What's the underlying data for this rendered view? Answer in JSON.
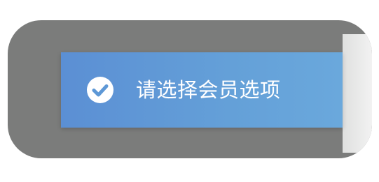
{
  "toast": {
    "message": "请选择会员选项",
    "icon": "check-circle-icon",
    "accent_color": "#5f98d6"
  }
}
